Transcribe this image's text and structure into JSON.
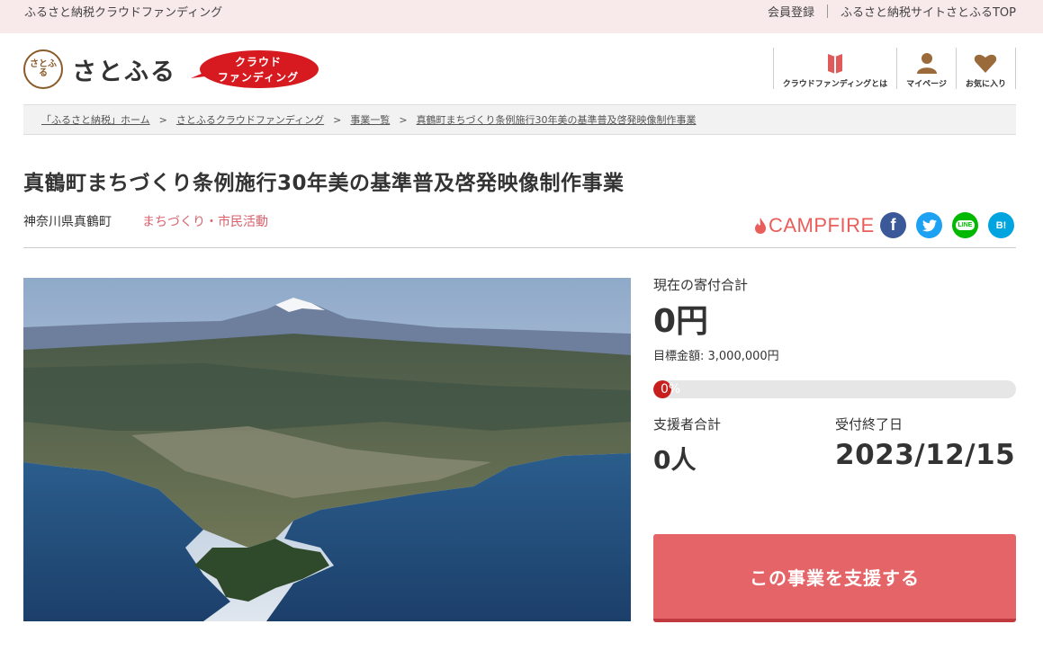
{
  "topbar": {
    "site_name": "ふるさと納税クラウドファンディング",
    "register": "会員登録",
    "top_link": "ふるさと納税サイトさとふるTOP"
  },
  "header": {
    "logo_text": "さとふる",
    "logo_mark": "さとふる",
    "badge_line1": "クラウド",
    "badge_line2": "ファンディング",
    "nav": [
      {
        "label": "クラウドファンディングとは",
        "icon": "book-icon"
      },
      {
        "label": "マイページ",
        "icon": "user-icon"
      },
      {
        "label": "お気に入り",
        "icon": "heart-icon"
      }
    ]
  },
  "breadcrumb": [
    "「ふるさと納税」ホーム",
    "さとふるクラウドファンディング",
    "事業一覧",
    "真鶴町まちづくり条例施行30年美の基準普及啓発映像制作事業"
  ],
  "breadcrumb_sep": ">",
  "project": {
    "title": "真鶴町まちづくり条例施行30年美の基準普及啓発映像制作事業",
    "prefecture": "神奈川県真鶴町",
    "category": "まちづくり・市民活動"
  },
  "partner": {
    "name": "CAMPFIRE"
  },
  "social": [
    {
      "name": "facebook-icon",
      "glyph": "f",
      "color": "#3b5998"
    },
    {
      "name": "twitter-icon",
      "glyph": "t",
      "color": "#1da1f2"
    },
    {
      "name": "line-icon",
      "glyph": "LINE",
      "color": "#00b900"
    },
    {
      "name": "hatena-bookmark-icon",
      "glyph": "B!",
      "color": "#00a4de"
    }
  ],
  "stats": {
    "current_label": "現在の寄付合計",
    "current_value": "0円",
    "goal_text": "目標金額: 3,000,000円",
    "progress_text": "0%",
    "progress": 0,
    "supporters_label": "支援者合計",
    "supporters_value": "0人",
    "deadline_label": "受付終了日",
    "deadline_value": "2023/12/15"
  },
  "cta": {
    "label": "この事業を支援する"
  },
  "colors": {
    "accent": "#e56468",
    "category": "#d9616c",
    "topbar": "#f8e9ea",
    "progress": "#c81e1e"
  }
}
